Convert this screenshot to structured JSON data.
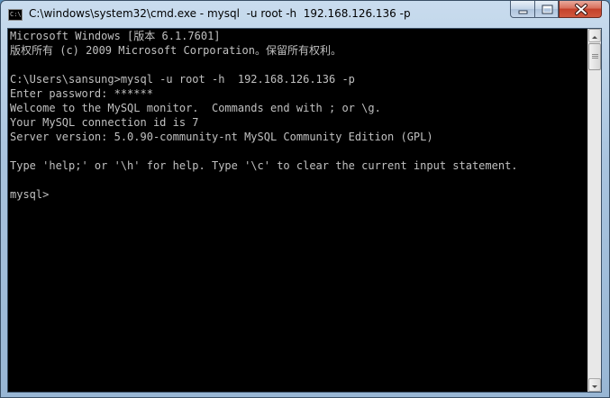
{
  "window": {
    "title": "C:\\windows\\system32\\cmd.exe - mysql  -u root -h  192.168.126.136 -p",
    "icon": "cmd-icon",
    "controls": [
      "minimize-icon",
      "maximize-icon",
      "close-icon"
    ]
  },
  "console": {
    "lines": [
      "Microsoft Windows [版本 6.1.7601]",
      "版权所有 (c) 2009 Microsoft Corporation。保留所有权利。",
      "",
      "C:\\Users\\sansung>mysql -u root -h  192.168.126.136 -p",
      "Enter password: ******",
      "Welcome to the MySQL monitor.  Commands end with ; or \\g.",
      "Your MySQL connection id is 7",
      "Server version: 5.0.90-community-nt MySQL Community Edition (GPL)",
      "",
      "Type 'help;' or '\\h' for help. Type '\\c' to clear the current input statement.",
      "",
      "mysql>"
    ]
  },
  "colors": {
    "console_bg": "#000000",
    "console_fg": "#c0c0c0"
  }
}
